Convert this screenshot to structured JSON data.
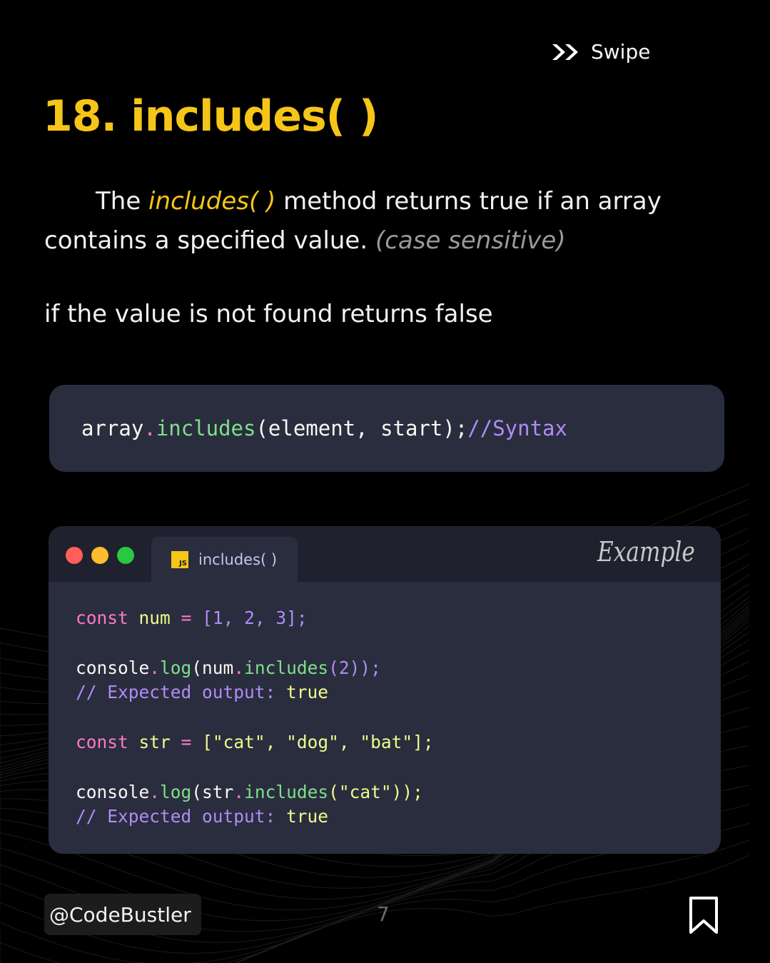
{
  "header": {
    "swipe_label": "Swipe",
    "title": "18. includes( )"
  },
  "description": {
    "part1": "The ",
    "method": "includes( )",
    "part2": " method returns true if an array contains a specified value. ",
    "note": "(case sensitive)"
  },
  "false_note": "if the value is not found returns false",
  "syntax": {
    "obj": "array",
    "dot": ".",
    "method": "includes",
    "args": "(element, start);",
    "comment": "//Syntax"
  },
  "editor": {
    "tab_label": "includes( )",
    "js_badge": "JS",
    "example_label": "Example",
    "code": {
      "l1_kw": "const",
      "l1_var": "num",
      "l1_eq": "=",
      "l1_val": "[1, 2, 3];",
      "l2_obj": "console",
      "l2_dot": ".",
      "l2_fn": "log",
      "l2_paren": "(num",
      "l2_dot2": ".",
      "l2_fn2": "includes",
      "l2_rest": "(2));",
      "l3_comment": "// Expected output:",
      "l3_val": "true",
      "l4_kw": "const",
      "l4_var": "str",
      "l4_eq": "=",
      "l4_val": "[\"cat\", \"dog\", \"bat\"];",
      "l5_obj": "console",
      "l5_dot": ".",
      "l5_fn": "log",
      "l5_paren": "(str",
      "l5_dot2": ".",
      "l5_fn2": "includes",
      "l5_rest": "(\"cat\"));",
      "l6_comment": "// Expected output:",
      "l6_val": "true"
    }
  },
  "footer": {
    "handle": "@CodeBustler",
    "page_number": "7"
  },
  "colors": {
    "accent": "#f5c518",
    "code_bg": "#2a2d3e",
    "keyword": "#ff79c6",
    "function": "#7ee08a",
    "comment": "#b08cf5"
  },
  "icons": {
    "swipe": "double-chevron-right-icon",
    "bookmark": "bookmark-icon"
  }
}
